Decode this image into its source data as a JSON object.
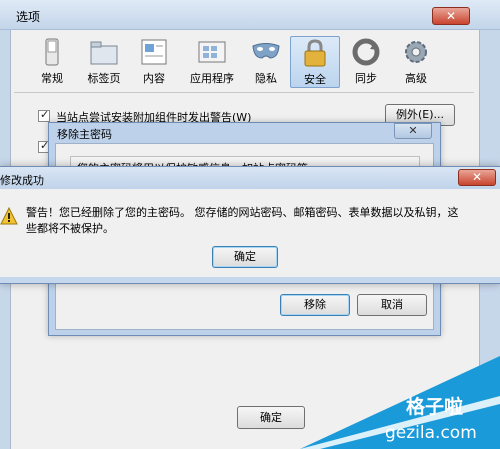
{
  "options_window": {
    "title": "选项",
    "tabs": [
      {
        "label": "常规",
        "icon": "switch-icon"
      },
      {
        "label": "标签页",
        "icon": "folder-icon"
      },
      {
        "label": "内容",
        "icon": "page-icon"
      },
      {
        "label": "应用程序",
        "icon": "apps-icon"
      },
      {
        "label": "隐私",
        "icon": "mask-icon"
      },
      {
        "label": "安全",
        "icon": "lock-icon",
        "selected": true
      },
      {
        "label": "同步",
        "icon": "sync-icon"
      },
      {
        "label": "高级",
        "icon": "gear-icon"
      }
    ],
    "addon_warning_label": "当站点尝试安装附加组件时发出警告(W)",
    "exceptions_button": "例外(E)...",
    "ok_button": "确定"
  },
  "remove_password_dialog": {
    "title": "移除主密码",
    "description": "您的主密码将用以保护敏感信息，如站点密码等。",
    "remove_button": "移除",
    "cancel_button": "取消"
  },
  "success_dialog": {
    "title": "修改成功",
    "message": "警告！您已经删除了您的主密码。 您存储的网站密码、邮箱密码、表单数据以及私钥，这些都将不被保护。",
    "ok_button": "确定"
  },
  "watermark": {
    "brand": "格子啦",
    "domain": "gezila.com"
  }
}
